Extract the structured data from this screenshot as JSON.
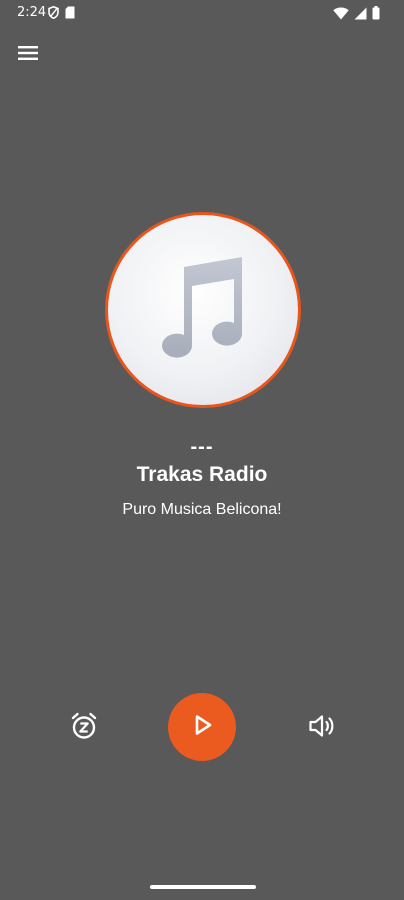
{
  "status_bar": {
    "time": "2:24",
    "icons": [
      "shield-icon",
      "sim-card-icon",
      "wifi-icon",
      "signal-icon",
      "battery-icon"
    ]
  },
  "toolbar": {
    "menu_icon": "hamburger-menu-icon"
  },
  "now_playing": {
    "artwork_icon": "music-note-icon",
    "track_title": "---",
    "station_name": "Trakas Radio",
    "station_slogan": "Puro Musica Belicona!"
  },
  "controls": {
    "sleep_timer_icon": "alarm-snooze-icon",
    "play_icon": "play-icon",
    "volume_icon": "volume-icon"
  },
  "colors": {
    "background": "#595959",
    "accent": "#eb5a1f",
    "text": "#ffffff"
  }
}
